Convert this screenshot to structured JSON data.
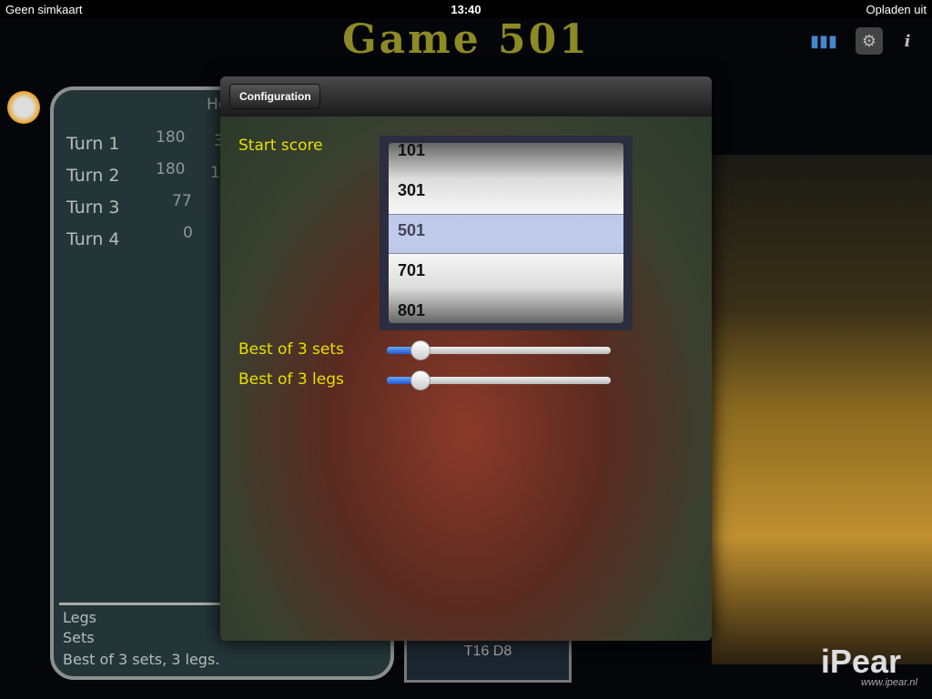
{
  "status": {
    "carrier": "Geen simkaart",
    "time": "13:40",
    "battery": "Opladen uit"
  },
  "header": {
    "title": "Game 501",
    "icons": [
      "stats-icon",
      "settings-gear-icon",
      "info-icon"
    ]
  },
  "board": {
    "header_partial": "Ho",
    "turns": [
      {
        "label": "Turn 1",
        "score": "180",
        "rest_partial": "3"
      },
      {
        "label": "Turn 2",
        "score": "180",
        "rest_partial": "1"
      },
      {
        "label": "Turn 3",
        "score": "77",
        "rest_partial": ""
      },
      {
        "label": "Turn 4",
        "score": "0",
        "rest_partial": ""
      }
    ],
    "legs": "Legs",
    "sets": "Sets",
    "summary": "Best of 3 sets, 3 legs."
  },
  "checkout": "T16 D8",
  "config": {
    "back_label": "Configuration",
    "start_score_label": "Start score",
    "options": [
      "101",
      "301",
      "501",
      "701",
      "801"
    ],
    "selected": "501",
    "sets_label": "Best of 3 sets",
    "legs_label": "Best of 3 legs",
    "sets_value_fraction": 0.15,
    "legs_value_fraction": 0.15
  },
  "brand": {
    "logo": "iPear",
    "url": "www.ipear.nl"
  }
}
